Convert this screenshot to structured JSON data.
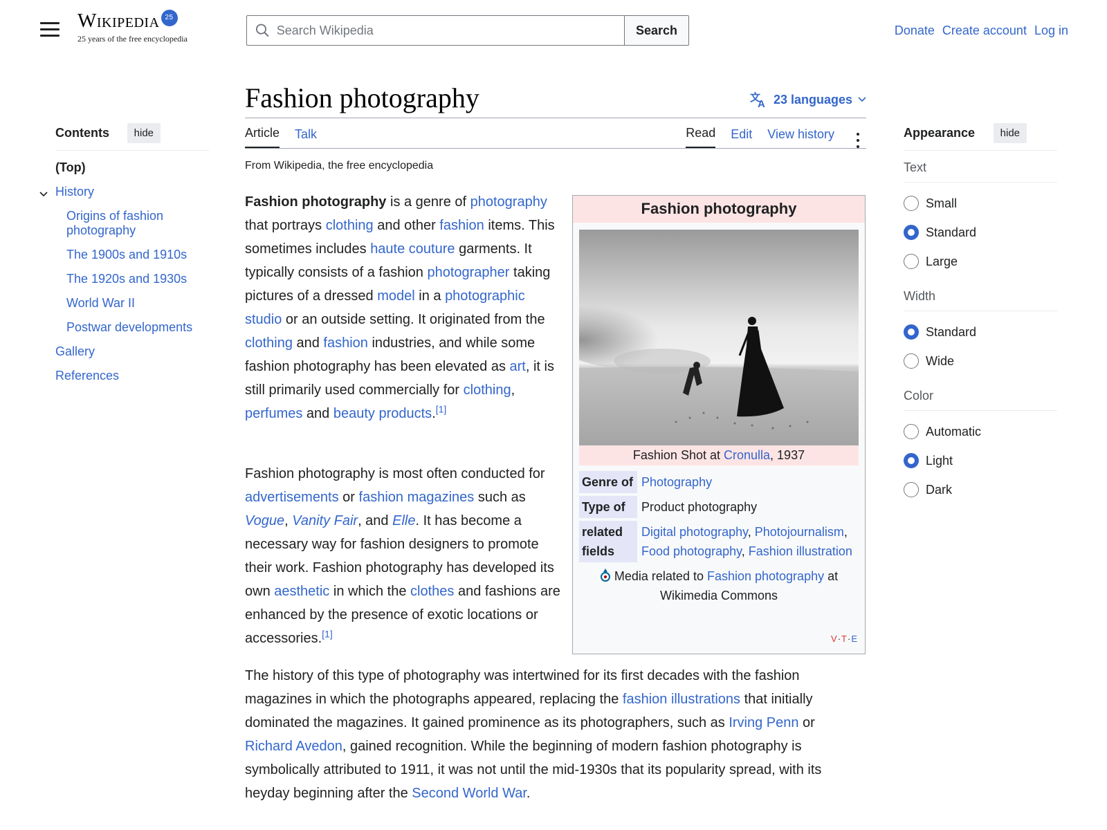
{
  "header": {
    "logo_word": "Wikipedia",
    "logo_badge": "25",
    "logo_tagline": "25 years of the free encyclopedia",
    "search_placeholder": "Search Wikipedia",
    "search_button": "Search",
    "user_links": [
      "Donate",
      "Create account",
      "Log in"
    ]
  },
  "toc": {
    "title": "Contents",
    "hide_label": "hide",
    "items": [
      {
        "label": "(Top)",
        "level": 0
      },
      {
        "label": "History",
        "level": 0
      },
      {
        "label": "Origins of fashion photography",
        "level": 1
      },
      {
        "label": "The 1900s and 1910s",
        "level": 1
      },
      {
        "label": "The 1920s and 1930s",
        "level": 1
      },
      {
        "label": "World War II",
        "level": 1
      },
      {
        "label": "Postwar developments",
        "level": 1
      },
      {
        "label": "Gallery",
        "level": 0
      },
      {
        "label": "References",
        "level": 0
      }
    ]
  },
  "article": {
    "title": "Fashion photography",
    "languages": "23 languages",
    "tabs_left": [
      "Article",
      "Talk"
    ],
    "tabs_right": [
      "Read",
      "Edit",
      "View history"
    ],
    "tagline": "From Wikipedia, the free encyclopedia",
    "p1": [
      {
        "b": "Fashion photography"
      },
      {
        "t": " is a genre of "
      },
      {
        "a": "photography"
      },
      {
        "t": " that portrays "
      },
      {
        "a": "clothing"
      },
      {
        "t": " and other "
      },
      {
        "a": "fashion"
      },
      {
        "t": " items. This sometimes includes "
      },
      {
        "a": "haute couture"
      },
      {
        "t": " garments. It typically consists of a fashion "
      },
      {
        "a": "photographer"
      },
      {
        "t": " taking pictures of a dressed "
      },
      {
        "a": "model"
      },
      {
        "t": " in a "
      },
      {
        "a": "photographic studio"
      },
      {
        "t": " or an outside setting. It originated from the "
      },
      {
        "a": "clothing"
      },
      {
        "t": " and "
      },
      {
        "a": "fashion"
      },
      {
        "t": " industries, and while some fashion photography has been elevated as "
      },
      {
        "a": "art"
      },
      {
        "t": ", it is still primarily used commercially for "
      },
      {
        "a": "clothing"
      },
      {
        "t": ", "
      },
      {
        "a": "perfumes"
      },
      {
        "t": " and "
      },
      {
        "a": "beauty products"
      },
      {
        "t": "."
      },
      {
        "sup": "[1]"
      }
    ],
    "p2": [
      {
        "t": "Fashion photography is most often conducted for "
      },
      {
        "a": "advertisements"
      },
      {
        "t": " or "
      },
      {
        "a": "fashion magazines"
      },
      {
        "t": " such as "
      },
      {
        "ai": "Vogue"
      },
      {
        "t": ", "
      },
      {
        "ai": "Vanity Fair"
      },
      {
        "t": ", and "
      },
      {
        "ai": "Elle"
      },
      {
        "t": ". It has become a necessary way for fashion designers to promote their work. Fashion photography has developed its own "
      },
      {
        "a": "aesthetic"
      },
      {
        "t": " in which the "
      },
      {
        "a": "clothes"
      },
      {
        "t": " and fashions are enhanced by the presence of exotic locations or accessories."
      },
      {
        "sup": "[1]"
      }
    ],
    "p3": [
      {
        "t": "The history of this type of photography was intertwined for its first decades with the fashion magazines in which the photographs appeared, replacing the "
      },
      {
        "a": "fashion illustrations"
      },
      {
        "t": " that initially dominated the magazines. It gained prominence as its photographers, such as "
      },
      {
        "a": "Irving Penn"
      },
      {
        "t": " or "
      },
      {
        "a": "Richard Avedon"
      },
      {
        "t": ", gained recognition. While the beginning of modern fashion photography is symbolically attributed to 1911, it was not until the mid-1930s that its popularity spread, with its heyday beginning after the "
      },
      {
        "a": "Second World War"
      },
      {
        "t": "."
      }
    ]
  },
  "infobox": {
    "title": "Fashion photography",
    "caption_pre": "Fashion Shot at ",
    "caption_link": "Cronulla",
    "caption_post": ", 1937",
    "genre_label": "Genre of",
    "genre_value": "Photography",
    "type_label": "Type of",
    "type_value": "Product photography",
    "related_label": "related fields",
    "related_values": [
      "Digital photography",
      "Photojournalism",
      "Food photography",
      "Fashion illustration"
    ],
    "commons_pre": "Media related to ",
    "commons_link": "Fashion photography",
    "commons_post": " at Wikimedia Commons",
    "vte": [
      "V",
      "T",
      "E"
    ]
  },
  "appearance": {
    "title": "Appearance",
    "hide_label": "hide",
    "groups": [
      {
        "label": "Text",
        "options": [
          "Small",
          "Standard",
          "Large"
        ],
        "selected": "Standard"
      },
      {
        "label": "Width",
        "options": [
          "Standard",
          "Wide"
        ],
        "selected": "Standard"
      },
      {
        "label": "Color",
        "options": [
          "Automatic",
          "Light",
          "Dark"
        ],
        "selected": "Light"
      }
    ]
  },
  "colors": {
    "link": "#3366cc",
    "infobox_header": "#fde4e4",
    "infobox_label": "#e4e6f8",
    "accent": "#3366cc"
  }
}
